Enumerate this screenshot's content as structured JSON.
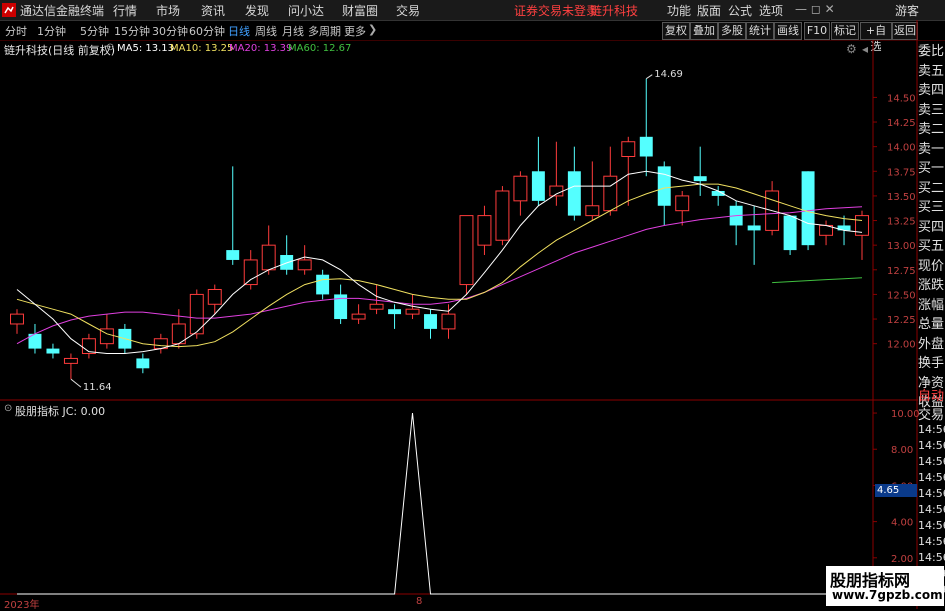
{
  "menu": {
    "app_title": "通达信金融终端",
    "items": [
      "行情",
      "市场",
      "资讯",
      "发现",
      "问小达",
      "财富圈",
      "交易"
    ],
    "notice": "证券交易未登录",
    "stock": "链升科技",
    "right_items": [
      "功能",
      "版面",
      "公式",
      "选项"
    ],
    "guest": "游客"
  },
  "periods": [
    "分时",
    "1分钟",
    "5分钟",
    "15分钟",
    "30分钟",
    "60分钟",
    "日线",
    "周线",
    "月线",
    "多周期",
    "更多"
  ],
  "active_period": "日线",
  "toolbar": [
    "复权",
    "叠加",
    "多股",
    "统计",
    "画线",
    "F10",
    "标记",
    "+自选",
    "返回"
  ],
  "header": {
    "title": "链升科技(日线 前复权)",
    "ma": [
      {
        "label": "MA5: 13.13",
        "color": "#ffffff"
      },
      {
        "label": "MA10: 13.25",
        "color": "#f0e060"
      },
      {
        "label": "MA20: 13.39",
        "color": "#e040e0"
      },
      {
        "label": "MA60: 12.67",
        "color": "#40c040"
      }
    ]
  },
  "price_axis": {
    "ticks": [
      "14.50",
      "14.25",
      "14.00",
      "13.75",
      "13.50",
      "13.25",
      "13.00",
      "12.75",
      "12.50",
      "12.25",
      "12.00"
    ],
    "min": 11.55,
    "max": 14.9
  },
  "annotations": {
    "high": "14.69",
    "low": "11.64"
  },
  "sub_header": "股朋指标  JC: 0.00",
  "sub_axis": {
    "ticks": [
      "10.00",
      "8.00",
      "6.00",
      "4.00",
      "2.00"
    ],
    "min": 0,
    "max": 10.5,
    "current": "4.65"
  },
  "side_labels": [
    "委比",
    "卖五",
    "卖四",
    "卖三",
    "卖二",
    "卖一",
    "买一",
    "买二",
    "买三",
    "买四",
    "买五",
    "现价",
    "涨跌",
    "涨幅",
    "总量",
    "外盘",
    "换手",
    "净资",
    "收益"
  ],
  "side_lower": [
    "自动",
    "交易"
  ],
  "side_times": [
    "14:56",
    "14:56",
    "14:56",
    "14:56",
    "14:56",
    "14:56",
    "14:56",
    "14:56",
    "14:56",
    "14:56",
    "14:56"
  ],
  "bottom": {
    "year": "2023年",
    "mark": "8"
  },
  "watermark": {
    "line1": "股朋指标网",
    "line2": "www.7gpzb.com"
  },
  "chart_data": {
    "type": "candlestick",
    "candles": [
      [
        12.2,
        12.3,
        12.35,
        12.1
      ],
      [
        12.1,
        11.95,
        12.2,
        11.9
      ],
      [
        11.95,
        11.9,
        12.0,
        11.85
      ],
      [
        11.8,
        11.85,
        11.9,
        11.64
      ],
      [
        11.9,
        12.05,
        12.1,
        11.85
      ],
      [
        12.0,
        12.15,
        12.3,
        11.95
      ],
      [
        12.15,
        11.95,
        12.2,
        11.9
      ],
      [
        11.85,
        11.75,
        11.9,
        11.7
      ],
      [
        11.95,
        12.05,
        12.1,
        11.9
      ],
      [
        12.0,
        12.2,
        12.35,
        11.95
      ],
      [
        12.1,
        12.5,
        12.55,
        12.05
      ],
      [
        12.4,
        12.55,
        12.6,
        12.3
      ],
      [
        12.95,
        12.85,
        13.8,
        12.8
      ],
      [
        12.6,
        12.85,
        12.95,
        12.55
      ],
      [
        12.75,
        13.0,
        13.2,
        12.7
      ],
      [
        12.9,
        12.75,
        13.1,
        12.7
      ],
      [
        12.75,
        12.85,
        13.0,
        12.7
      ],
      [
        12.7,
        12.5,
        12.75,
        12.45
      ],
      [
        12.5,
        12.25,
        12.6,
        12.2
      ],
      [
        12.25,
        12.3,
        12.4,
        12.2
      ],
      [
        12.35,
        12.4,
        12.6,
        12.3
      ],
      [
        12.35,
        12.3,
        12.4,
        12.15
      ],
      [
        12.3,
        12.35,
        12.5,
        12.25
      ],
      [
        12.3,
        12.15,
        12.35,
        12.05
      ],
      [
        12.15,
        12.3,
        12.4,
        12.05
      ],
      [
        12.6,
        13.3,
        13.3,
        12.5
      ],
      [
        13.0,
        13.3,
        13.4,
        12.9
      ],
      [
        13.05,
        13.55,
        13.6,
        13.0
      ],
      [
        13.45,
        13.7,
        13.75,
        13.3
      ],
      [
        13.75,
        13.45,
        14.1,
        13.4
      ],
      [
        13.5,
        13.6,
        14.05,
        13.4
      ],
      [
        13.75,
        13.3,
        14.0,
        13.25
      ],
      [
        13.3,
        13.4,
        13.85,
        13.25
      ],
      [
        13.35,
        13.7,
        14.0,
        13.3
      ],
      [
        13.9,
        14.05,
        14.1,
        13.4
      ],
      [
        14.1,
        13.9,
        14.69,
        13.7
      ],
      [
        13.8,
        13.4,
        13.85,
        13.2
      ],
      [
        13.35,
        13.5,
        13.55,
        13.2
      ],
      [
        13.7,
        13.65,
        14.0,
        13.5
      ],
      [
        13.55,
        13.5,
        13.6,
        13.4
      ],
      [
        13.4,
        13.2,
        13.45,
        13.0
      ],
      [
        13.2,
        13.15,
        13.4,
        12.8
      ],
      [
        13.15,
        13.55,
        13.65,
        13.1
      ],
      [
        13.3,
        12.95,
        13.3,
        12.9
      ],
      [
        13.75,
        13.0,
        13.75,
        12.95
      ],
      [
        13.1,
        13.2,
        13.25,
        13.0
      ],
      [
        13.2,
        13.15,
        13.3,
        13.0
      ],
      [
        13.1,
        13.3,
        13.35,
        12.85
      ]
    ],
    "ma5": [
      12.55,
      12.4,
      12.25,
      12.05,
      11.92,
      11.9,
      11.9,
      11.92,
      11.95,
      12.0,
      12.12,
      12.3,
      12.5,
      12.65,
      12.75,
      12.82,
      12.88,
      12.85,
      12.75,
      12.6,
      12.48,
      12.42,
      12.38,
      12.35,
      12.33,
      12.5,
      12.72,
      12.95,
      13.2,
      13.4,
      13.52,
      13.6,
      13.6,
      13.6,
      13.72,
      13.75,
      13.72,
      13.66,
      13.62,
      13.55,
      13.45,
      13.4,
      13.35,
      13.3,
      13.22,
      13.2,
      13.15,
      13.13
    ],
    "ma10": [
      12.45,
      12.4,
      12.35,
      12.3,
      12.2,
      12.1,
      12.05,
      12.0,
      11.98,
      11.97,
      11.98,
      12.02,
      12.12,
      12.25,
      12.38,
      12.5,
      12.6,
      12.65,
      12.66,
      12.64,
      12.6,
      12.55,
      12.5,
      12.47,
      12.45,
      12.45,
      12.52,
      12.62,
      12.78,
      12.92,
      13.05,
      13.15,
      13.25,
      13.35,
      13.45,
      13.52,
      13.58,
      13.6,
      13.62,
      13.62,
      13.58,
      13.52,
      13.46,
      13.4,
      13.34,
      13.3,
      13.27,
      13.25
    ],
    "ma20": [
      12.0,
      12.1,
      12.18,
      12.24,
      12.28,
      12.3,
      12.32,
      12.32,
      12.3,
      12.28,
      12.26,
      12.26,
      12.28,
      12.3,
      12.34,
      12.38,
      12.42,
      12.44,
      12.46,
      12.46,
      12.44,
      12.42,
      12.4,
      12.4,
      12.42,
      12.46,
      12.52,
      12.6,
      12.68,
      12.76,
      12.84,
      12.92,
      12.98,
      13.04,
      13.1,
      13.16,
      13.2,
      13.23,
      13.26,
      13.28,
      13.3,
      13.31,
      13.32,
      13.33,
      13.35,
      13.37,
      13.38,
      13.39
    ],
    "ma60_tail": [
      12.62,
      12.63,
      12.64,
      12.65,
      12.66,
      12.67
    ],
    "jc_spike_index": 22,
    "jc_spike_value": 10
  }
}
